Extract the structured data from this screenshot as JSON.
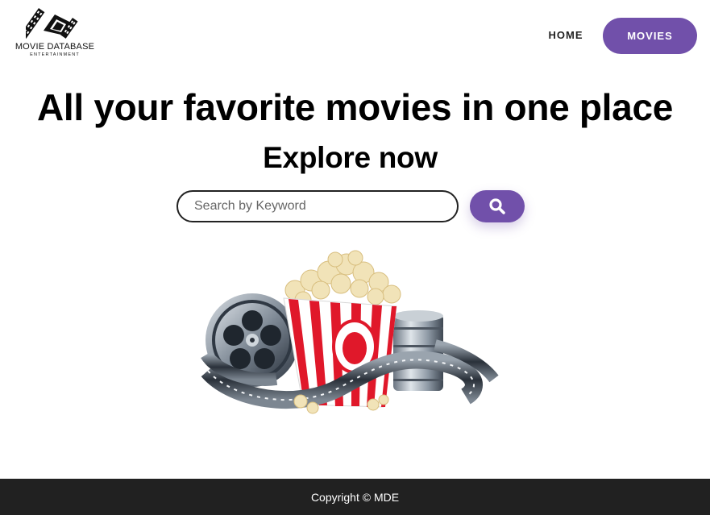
{
  "brand": {
    "title": "MOVIE DATABASE",
    "subtitle": "ENTERTAINMENT",
    "logo_icon": "film-clapper-logo"
  },
  "nav": {
    "home_label": "HOME",
    "movies_label": "MOVIES"
  },
  "hero": {
    "title": "All your favorite movies in one place",
    "subtitle": "Explore now",
    "illustration": "popcorn-film-reel-illustration"
  },
  "search": {
    "placeholder": "Search by Keyword",
    "value": "",
    "button_icon": "search-icon"
  },
  "footer": {
    "copyright": "Copyright © MDE"
  },
  "colors": {
    "accent": "#7150aa",
    "footer_bg": "#212121",
    "text": "#000000"
  }
}
